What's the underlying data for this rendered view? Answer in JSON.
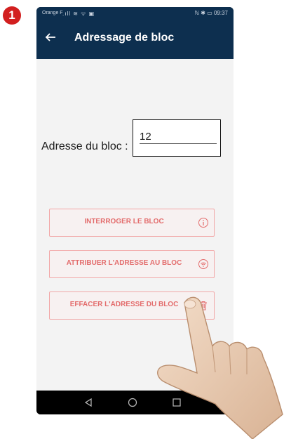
{
  "step_badge": "1",
  "statusbar": {
    "carrier": "Orange F",
    "signal": ".ıll ≋ ᯤ ▣",
    "right": "ℕ ✱ ▭ 09:37"
  },
  "appbar": {
    "back_icon": "arrow-left-icon",
    "title": "Adressage de bloc"
  },
  "address": {
    "label": "Adresse du bloc :",
    "value": "12"
  },
  "buttons": [
    {
      "label": "INTERROGER LE BLOC",
      "icon": "info-icon"
    },
    {
      "label": "ATTRIBUER L'ADRESSE AU BLOC",
      "icon": "wifi-icon"
    },
    {
      "label": "EFFACER L'ADRESSE DU BLOC",
      "icon": "trash-icon"
    }
  ],
  "colors": {
    "appbar": "#0d2f4f",
    "button_text": "#e36c6c",
    "button_border": "#f2a7a7",
    "badge": "#d21f1f"
  }
}
